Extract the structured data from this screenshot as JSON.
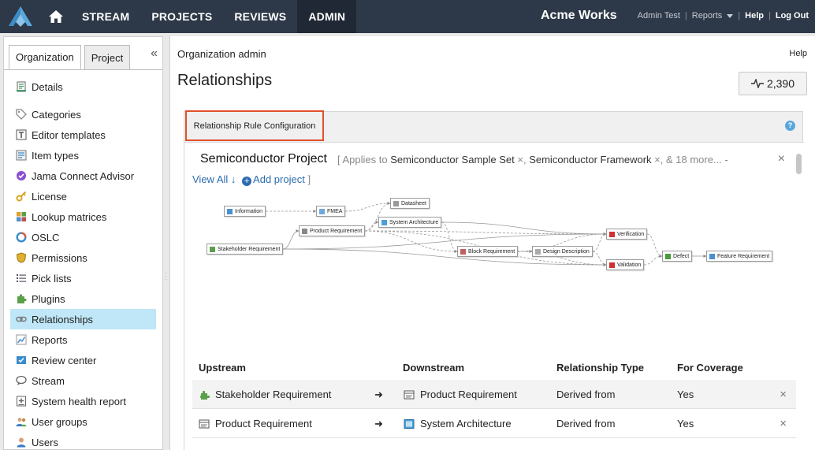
{
  "nav": {
    "tabs": [
      "STREAM",
      "PROJECTS",
      "REVIEWS",
      "ADMIN"
    ],
    "active": "ADMIN",
    "org_name": "Acme Works",
    "user": "Admin Test",
    "reports": "Reports",
    "help": "Help",
    "logout": "Log Out",
    "sep": "|"
  },
  "sidebar": {
    "tabs": [
      "Organization",
      "Project"
    ],
    "collapse": "«",
    "items": [
      {
        "label": "Details",
        "icon": "details-icon"
      },
      {
        "label": "Categories",
        "icon": "tag-icon"
      },
      {
        "label": "Editor templates",
        "icon": "template-icon"
      },
      {
        "label": "Item types",
        "icon": "item-types-icon"
      },
      {
        "label": "Jama Connect Advisor",
        "icon": "advisor-icon"
      },
      {
        "label": "License",
        "icon": "key-icon"
      },
      {
        "label": "Lookup matrices",
        "icon": "matrix-icon"
      },
      {
        "label": "OSLC",
        "icon": "oslc-icon"
      },
      {
        "label": "Permissions",
        "icon": "shield-icon"
      },
      {
        "label": "Pick lists",
        "icon": "list-icon"
      },
      {
        "label": "Plugins",
        "icon": "puzzle-icon"
      },
      {
        "label": "Relationships",
        "icon": "link-icon"
      },
      {
        "label": "Reports",
        "icon": "chart-icon"
      },
      {
        "label": "Review center",
        "icon": "review-icon"
      },
      {
        "label": "Stream",
        "icon": "stream-icon"
      },
      {
        "label": "System health report",
        "icon": "health-icon"
      },
      {
        "label": "User groups",
        "icon": "groups-icon"
      },
      {
        "label": "Users",
        "icon": "users-icon"
      }
    ],
    "active": "Relationships"
  },
  "main": {
    "breadcrumb": "Organization admin",
    "help": "Help",
    "title": "Relationships",
    "count": "2,390",
    "panel_title": "Relationship Rule Configuration",
    "help_q": "?",
    "project_name": "Semiconductor Project",
    "applies_prefix": "[ Applies to ",
    "applies_1": "Semiconductor Sample Set",
    "applies_2": "Semiconductor Framework",
    "applies_more": "& 18 more...",
    "applies_x": "×",
    "applies_dash": " -",
    "close": "×",
    "view_all": "View All",
    "down_arrow": "↓",
    "add_project": "Add project",
    "bracket_close": "]",
    "plus": "+"
  },
  "diagram": {
    "nodes": [
      {
        "id": "information",
        "label": "Information",
        "color": "#4a8fd0"
      },
      {
        "id": "fmea",
        "label": "FMEA",
        "color": "#6fa8dc"
      },
      {
        "id": "datasheet",
        "label": "Datasheet",
        "color": "#999999"
      },
      {
        "id": "product",
        "label": "Product Requirement",
        "color": "#888888"
      },
      {
        "id": "sysarch",
        "label": "System Architecture",
        "color": "#4a9fd8"
      },
      {
        "id": "stakeholder",
        "label": "Stakeholder Requirement",
        "color": "#5aa04a"
      },
      {
        "id": "block",
        "label": "Block Requirement",
        "color": "#c06060"
      },
      {
        "id": "design",
        "label": "Design Description",
        "color": "#aaaaaa"
      },
      {
        "id": "verification",
        "label": "Verification",
        "color": "#d03030"
      },
      {
        "id": "validation",
        "label": "Validation",
        "color": "#d03030"
      },
      {
        "id": "defect",
        "label": "Defect",
        "color": "#4a9a3a"
      },
      {
        "id": "feature",
        "label": "Feature Requirement",
        "color": "#4a8fd0"
      }
    ]
  },
  "table": {
    "headers": [
      "Upstream",
      "Downstream",
      "Relationship Type",
      "For Coverage"
    ],
    "arrow": "➜",
    "remove": "×",
    "rows": [
      {
        "upstream": "Stakeholder Requirement",
        "downstream": "Product Requirement",
        "type": "Derived from",
        "coverage": "Yes"
      },
      {
        "upstream": "Product Requirement",
        "downstream": "System Architecture",
        "type": "Derived from",
        "coverage": "Yes"
      }
    ]
  }
}
